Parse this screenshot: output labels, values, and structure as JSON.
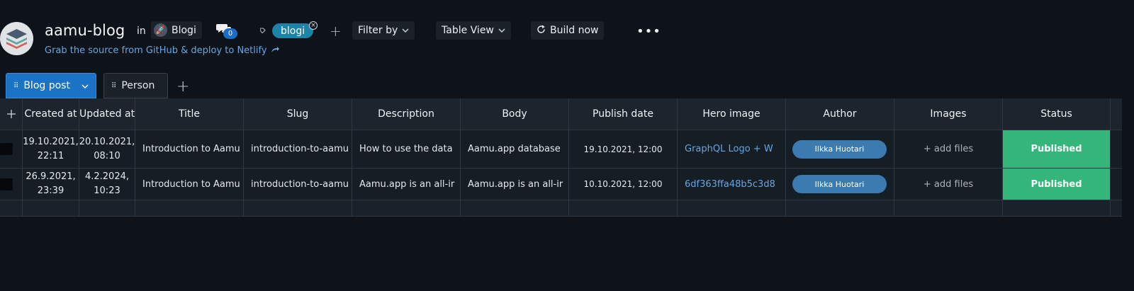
{
  "header": {
    "title": "aamu-blog",
    "in_label": "in",
    "space_name": "Blogi",
    "subtitle": "Grab the source from GitHub & deploy to Netlify",
    "comment_count": "0",
    "tag": "blogi",
    "filter_label": "Filter by",
    "view_label": "Table View",
    "build_label": "Build now"
  },
  "tabs": [
    {
      "label": "Blog post",
      "active": true
    },
    {
      "label": "Person",
      "active": false
    }
  ],
  "table": {
    "columns": [
      "Created at",
      "Updated at",
      "Title",
      "Slug",
      "Description",
      "Body",
      "Publish date",
      "Hero image",
      "Author",
      "Images",
      "Status"
    ],
    "rows": [
      {
        "created_date": "19.10.2021,",
        "created_time": "22:11",
        "updated_date": "20.10.2021,",
        "updated_time": "08:10",
        "title": "Introduction to Aamu",
        "slug": "introduction-to-aamu",
        "description": "How to use the data",
        "body": "Aamu.app database",
        "publish_date": "19.10.2021, 12:00",
        "hero_image": "GraphQL Logo + W",
        "author": "Ilkka Huotari",
        "images": "+ add files",
        "status": "Published"
      },
      {
        "created_date": "26.9.2021,",
        "created_time": "23:39",
        "updated_date": "4.2.2024,",
        "updated_time": "10:23",
        "title": "Introduction to Aamu",
        "slug": "introduction-to-aamu",
        "description": "Aamu.app is an all-ir",
        "body": "Aamu.app is an all-ir",
        "publish_date": "10.10.2021, 12:00",
        "hero_image": "6df363ffa48b5c3d8",
        "author": "Ilkka Huotari",
        "images": "+ add files",
        "status": "Published"
      }
    ]
  },
  "colors": {
    "background": "#0e131a",
    "accent": "#1a73c4",
    "tag": "#1b84a8",
    "status_published": "#34b67a",
    "author_chip": "#3b7bb0",
    "link": "#6aa5e0"
  },
  "icons": [
    "database-stack-icon",
    "rocket-icon",
    "external-link-icon",
    "comments-icon",
    "tag-icon",
    "remove-tag-icon",
    "add-tag-icon",
    "chevron-down-icon",
    "refresh-icon",
    "more-icon",
    "grid-icon",
    "add-tab-icon",
    "add-row-icon"
  ]
}
